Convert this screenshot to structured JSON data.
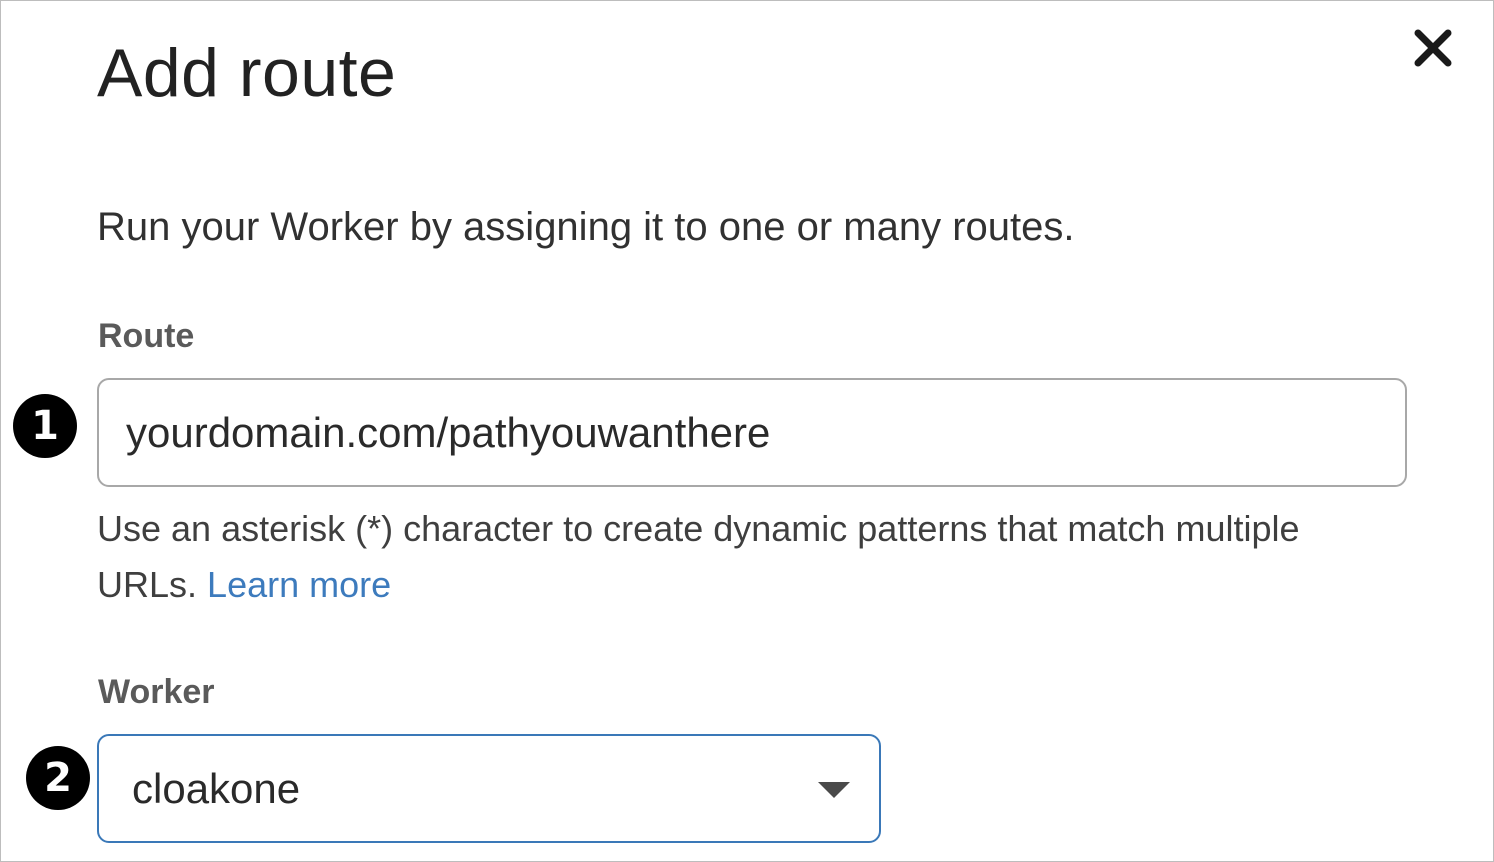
{
  "dialog": {
    "title": "Add route",
    "close_icon": "close-icon",
    "description": "Run your Worker by assigning it to one or many routes."
  },
  "route": {
    "label": "Route",
    "value": "yourdomain.com/pathyouwanthere",
    "hint": "Use an asterisk (*) character to create dynamic patterns that match multiple URLs.",
    "learn_more": "Learn more"
  },
  "worker": {
    "label": "Worker",
    "selected": "cloakone",
    "dropdown_icon": "chevron-down-icon"
  },
  "markers": [
    "1",
    "2"
  ],
  "colors": {
    "link": "#3d7bbd",
    "focus_border": "#3a78b8",
    "marker_bg": "#000000"
  }
}
